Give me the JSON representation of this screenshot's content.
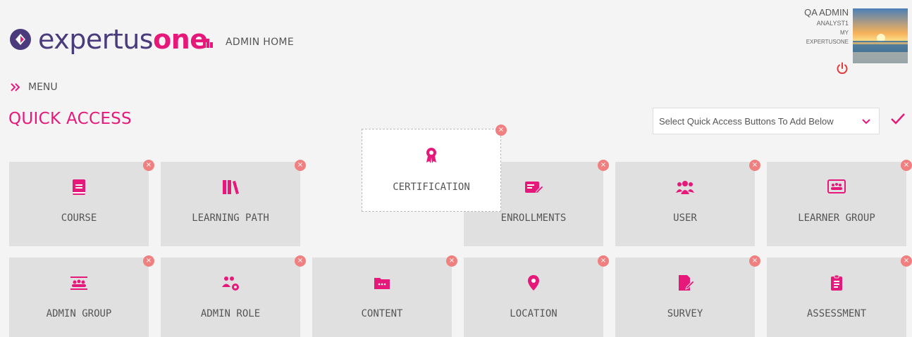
{
  "header": {
    "logo_text_a": "expertus",
    "logo_text_b": "one",
    "admin_home": "ADMIN HOME",
    "user_name": "QA ADMIN",
    "user_role": "ANALYST1",
    "user_link_1": "MY",
    "user_link_2": "EXPERTUSONE"
  },
  "menu": {
    "label": "MENU"
  },
  "quick_access": {
    "title": "QUICK ACCESS",
    "select_placeholder": "Select Quick Access Buttons To Add Below"
  },
  "colors": {
    "accent": "#e6197a",
    "brand_purple": "#4a3b7c",
    "remove": "#f08080"
  },
  "tiles": [
    {
      "label": "COURSE",
      "icon": "book-icon"
    },
    {
      "label": "LEARNING PATH",
      "icon": "books-icon"
    },
    {
      "label": "ENROLLMENTS",
      "icon": "pencil-card-icon"
    },
    {
      "label": "USER",
      "icon": "users-icon"
    },
    {
      "label": "LEARNER GROUP",
      "icon": "group-board-icon"
    },
    {
      "label": "ADMIN GROUP",
      "icon": "admin-group-icon"
    },
    {
      "label": "ADMIN ROLE",
      "icon": "admin-role-icon"
    },
    {
      "label": "CONTENT",
      "icon": "folder-icon"
    },
    {
      "label": "LOCATION",
      "icon": "location-pin-icon"
    },
    {
      "label": "SURVEY",
      "icon": "survey-icon"
    },
    {
      "label": "ASSESSMENT",
      "icon": "clipboard-icon"
    }
  ],
  "dragging_tile": {
    "label": "CERTIFICATION",
    "icon": "award-icon"
  }
}
